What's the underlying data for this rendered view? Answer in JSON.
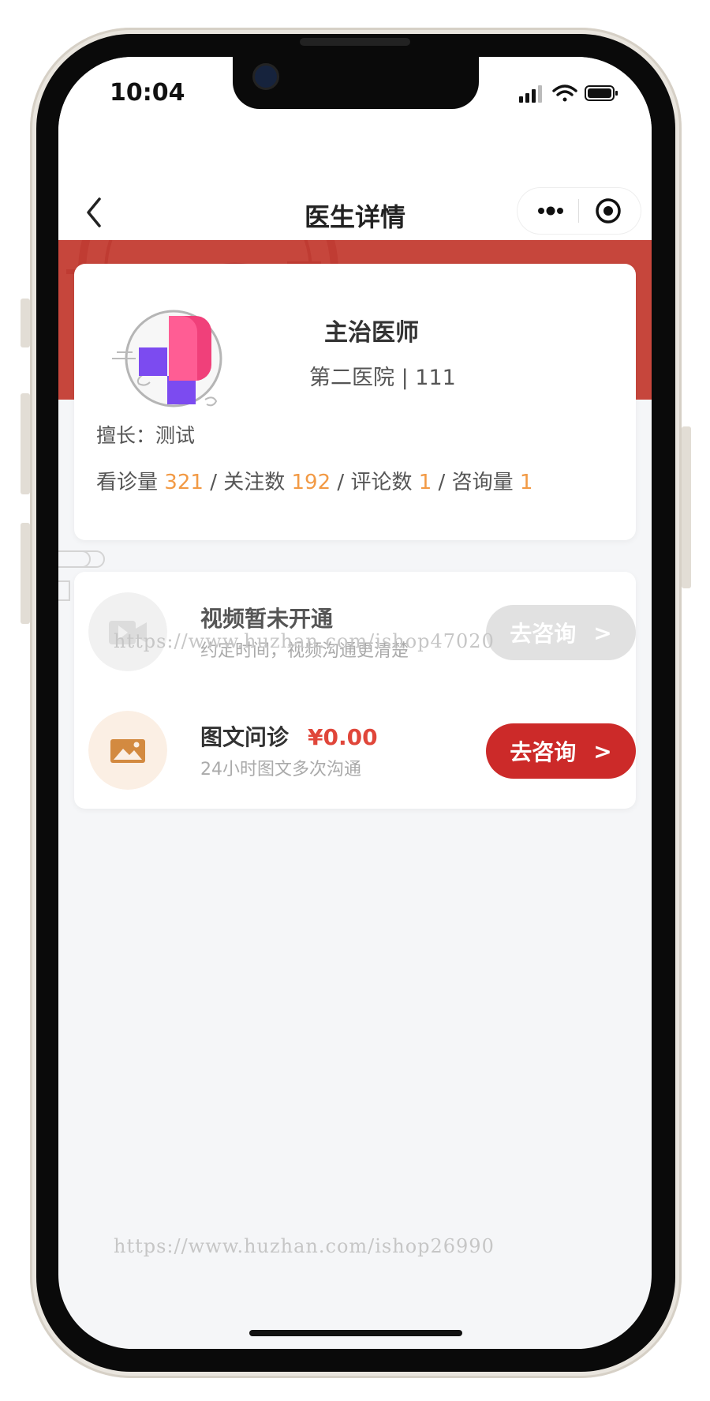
{
  "status_bar": {
    "time": "10:04",
    "icons": [
      "cellular-signal-icon",
      "wifi-icon",
      "battery-icon"
    ]
  },
  "nav": {
    "title": "医生详情",
    "back_icon": "chevron-left-icon",
    "more_icon": "more-dots-icon",
    "close_icon": "target-circle-icon"
  },
  "doctor": {
    "title": "主治医师",
    "hospital": "第二医院 | 111",
    "specialty": "擅长：测试",
    "stats": [
      {
        "label": "看诊量",
        "value": "321"
      },
      {
        "label": "关注数",
        "value": "192"
      },
      {
        "label": "评论数",
        "value": "1"
      },
      {
        "label": "咨询量",
        "value": "1"
      }
    ]
  },
  "services": {
    "video": {
      "name": "视频暂未开通",
      "subtitle": "约定时间，视频沟通更清楚",
      "button": "去咨询",
      "arrow": ">",
      "icon": "video-camera-icon"
    },
    "text": {
      "name": "图文问诊",
      "price": "¥0.00",
      "subtitle": "24小时图文多次沟通",
      "button": "去咨询",
      "arrow": ">",
      "icon": "image-icon"
    }
  },
  "watermarks": {
    "top": "https://www.huzhan.com/ishop47020",
    "bottom": "https://www.huzhan.com/ishop26990"
  },
  "colors": {
    "banner": "#c6463c",
    "accent_red": "#cc2a29",
    "price_red": "#e0463a",
    "stat_orange": "#f29a45",
    "disabled_gray": "#e1e1e1"
  }
}
